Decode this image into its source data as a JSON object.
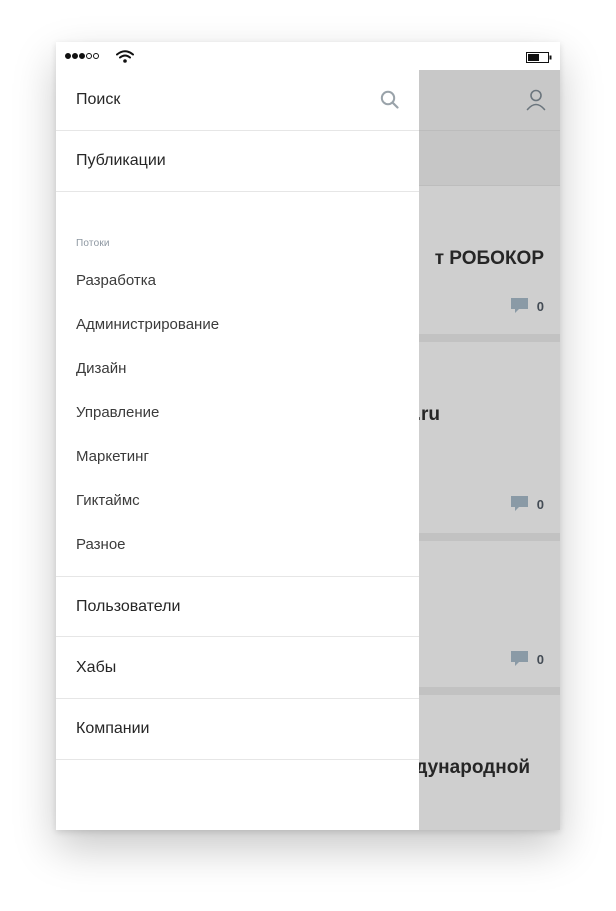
{
  "drawer": {
    "search_label": "Поиск",
    "publications_label": "Публикации",
    "flows_section_label": "Потоки",
    "flows": [
      {
        "label": "Разработка"
      },
      {
        "label": "Администрирование"
      },
      {
        "label": "Дизайн"
      },
      {
        "label": "Управление"
      },
      {
        "label": "Маркетинг"
      },
      {
        "label": "Гиктаймс"
      },
      {
        "label": "Разное"
      }
    ],
    "users_label": "Пользователи",
    "hubs_label": "Хабы",
    "companies_label": "Компании"
  },
  "background_feed": {
    "posts": [
      {
        "title_visible": "т РОБОКОР",
        "comments": "0"
      },
      {
        "title_visible": ".ru",
        "comments": "0"
      },
      {
        "title_visible": "",
        "comments": "0"
      },
      {
        "title_visible": "дународной"
      }
    ]
  },
  "icons": {
    "search": "search-icon",
    "user": "user-icon",
    "comment": "comment-icon",
    "wifi": "wifi-icon",
    "battery": "battery-icon"
  },
  "colors": {
    "overlay": "#d2d2d2",
    "text": "#262626",
    "section_label": "#8c96a0",
    "comment_icon": "#8a9aa6"
  }
}
